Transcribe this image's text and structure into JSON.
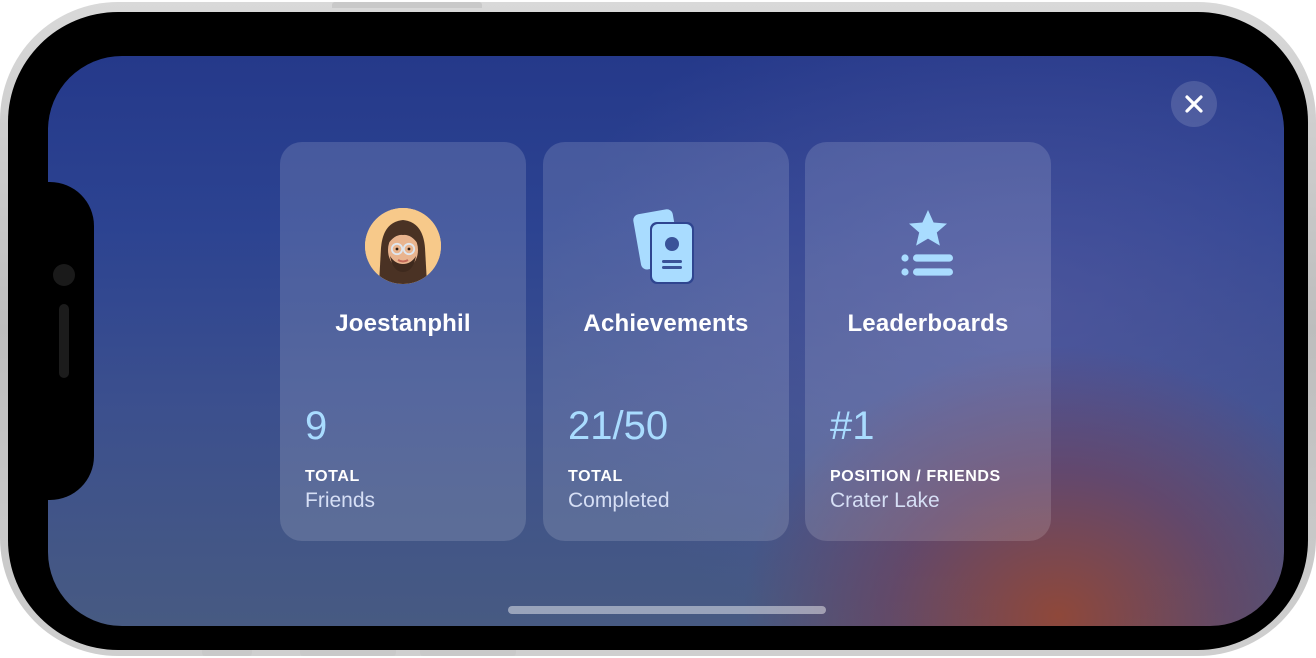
{
  "colors": {
    "accent_value": "#a9dcff",
    "icon_fill": "#a9dcff",
    "card_background": "rgba(255,255,255,0.14)"
  },
  "close_button": {
    "icon": "close-icon"
  },
  "cards": [
    {
      "icon": "avatar",
      "title": "Joestanphil",
      "value": "9",
      "caption": "TOTAL",
      "subtitle": "Friends"
    },
    {
      "icon": "achievements-icon",
      "title": "Achievements",
      "value": "21/50",
      "caption": "TOTAL",
      "subtitle": "Completed"
    },
    {
      "icon": "leaderboard-icon",
      "title": "Leaderboards",
      "value": "#1",
      "caption": "POSITION / FRIENDS",
      "subtitle": "Crater Lake"
    }
  ]
}
